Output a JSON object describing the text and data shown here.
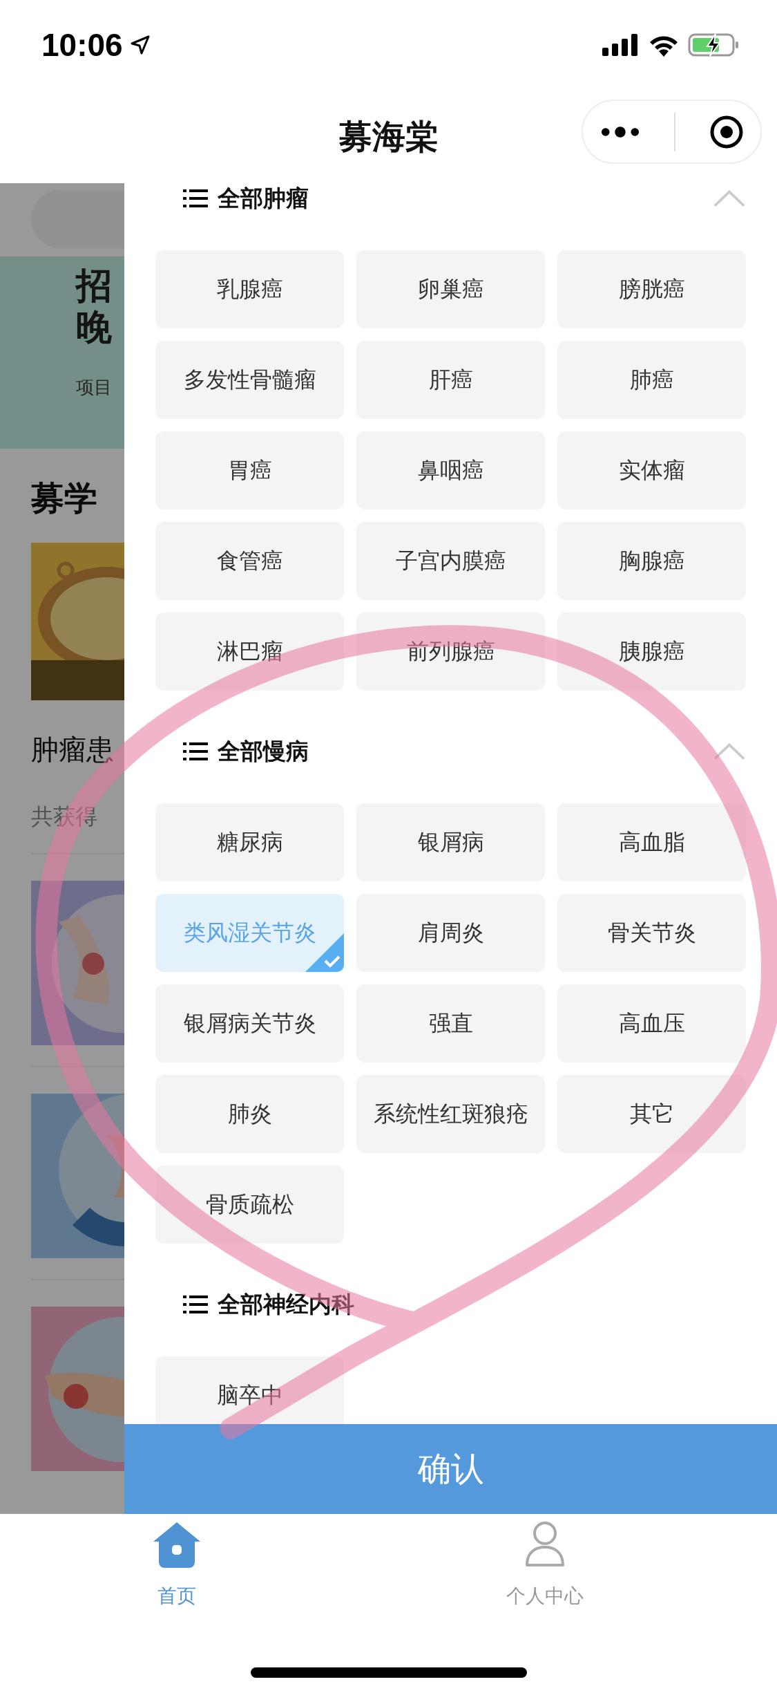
{
  "status_bar": {
    "time": "10:06"
  },
  "nav": {
    "title": "募海棠"
  },
  "background": {
    "banner_lines": [
      "招",
      "晚"
    ],
    "banner_note": "项目",
    "section_title": "募学",
    "article_title": "肿瘤患",
    "article_meta": "共获得"
  },
  "filter": {
    "sections": [
      {
        "title": "全部肿瘤",
        "expanded": true,
        "items": [
          {
            "label": "乳腺癌",
            "selected": false
          },
          {
            "label": "卵巢癌",
            "selected": false
          },
          {
            "label": "膀胱癌",
            "selected": false
          },
          {
            "label": "多发性骨髓瘤",
            "selected": false
          },
          {
            "label": "肝癌",
            "selected": false
          },
          {
            "label": "肺癌",
            "selected": false
          },
          {
            "label": "胃癌",
            "selected": false
          },
          {
            "label": "鼻咽癌",
            "selected": false
          },
          {
            "label": "实体瘤",
            "selected": false
          },
          {
            "label": "食管癌",
            "selected": false
          },
          {
            "label": "子宫内膜癌",
            "selected": false
          },
          {
            "label": "胸腺癌",
            "selected": false
          },
          {
            "label": "淋巴瘤",
            "selected": false
          },
          {
            "label": "前列腺癌",
            "selected": false
          },
          {
            "label": "胰腺癌",
            "selected": false
          }
        ]
      },
      {
        "title": "全部慢病",
        "expanded": true,
        "items": [
          {
            "label": "糖尿病",
            "selected": false
          },
          {
            "label": "银屑病",
            "selected": false
          },
          {
            "label": "高血脂",
            "selected": false
          },
          {
            "label": "类风湿关节炎",
            "selected": true
          },
          {
            "label": "肩周炎",
            "selected": false
          },
          {
            "label": "骨关节炎",
            "selected": false
          },
          {
            "label": "银屑病关节炎",
            "selected": false
          },
          {
            "label": "强直",
            "selected": false
          },
          {
            "label": "高血压",
            "selected": false
          },
          {
            "label": "肺炎",
            "selected": false
          },
          {
            "label": "系统性红斑狼疮",
            "selected": false
          },
          {
            "label": "其它",
            "selected": false
          },
          {
            "label": "骨质疏松",
            "selected": false
          }
        ]
      },
      {
        "title": "全部神经内科",
        "items": [
          {
            "label": "脑卒中",
            "selected": false
          }
        ]
      }
    ],
    "confirm": "确认"
  },
  "tab_bar": {
    "tabs": [
      {
        "label": "首页",
        "kind": "home",
        "selected": true
      },
      {
        "label": "个人中心",
        "kind": "person",
        "selected": false
      }
    ]
  }
}
